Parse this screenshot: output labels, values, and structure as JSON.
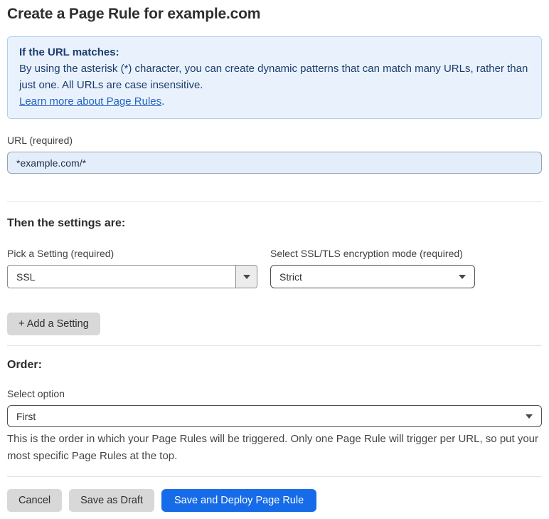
{
  "page": {
    "title": "Create a Page Rule for example.com"
  },
  "info_box": {
    "heading": "If the URL matches:",
    "body": "By using the asterisk (*) character, you can create dynamic patterns that can match many URLs, rather than just one. All URLs are case insensitive.",
    "link_label": "Learn more about Page Rules",
    "link_suffix": "."
  },
  "url_field": {
    "label": "URL (required)",
    "value": "*example.com/*"
  },
  "settings": {
    "heading": "Then the settings are:",
    "setting_select": {
      "label": "Pick a Setting (required)",
      "value": "SSL"
    },
    "mode_select": {
      "label": "Select SSL/TLS encryption mode (required)",
      "value": "Strict"
    },
    "add_button_label": "+ Add a Setting"
  },
  "order": {
    "heading": "Order:",
    "select_label": "Select option",
    "select_value": "First",
    "help_text": "This is the order in which your Page Rules will be triggered. Only one Page Rule will trigger per URL, so put your most specific Page Rules at the top."
  },
  "footer": {
    "cancel_label": "Cancel",
    "save_draft_label": "Save as Draft",
    "save_deploy_label": "Save and Deploy Page Rule"
  },
  "colors": {
    "accent_blue": "#166be8",
    "info_background": "#e9f2fc",
    "info_border": "#b3cdf0",
    "info_text": "#1d3c6e",
    "link_blue": "#2563c2",
    "url_input_background": "#e4eefb",
    "button_gray": "#d8d8d8"
  }
}
